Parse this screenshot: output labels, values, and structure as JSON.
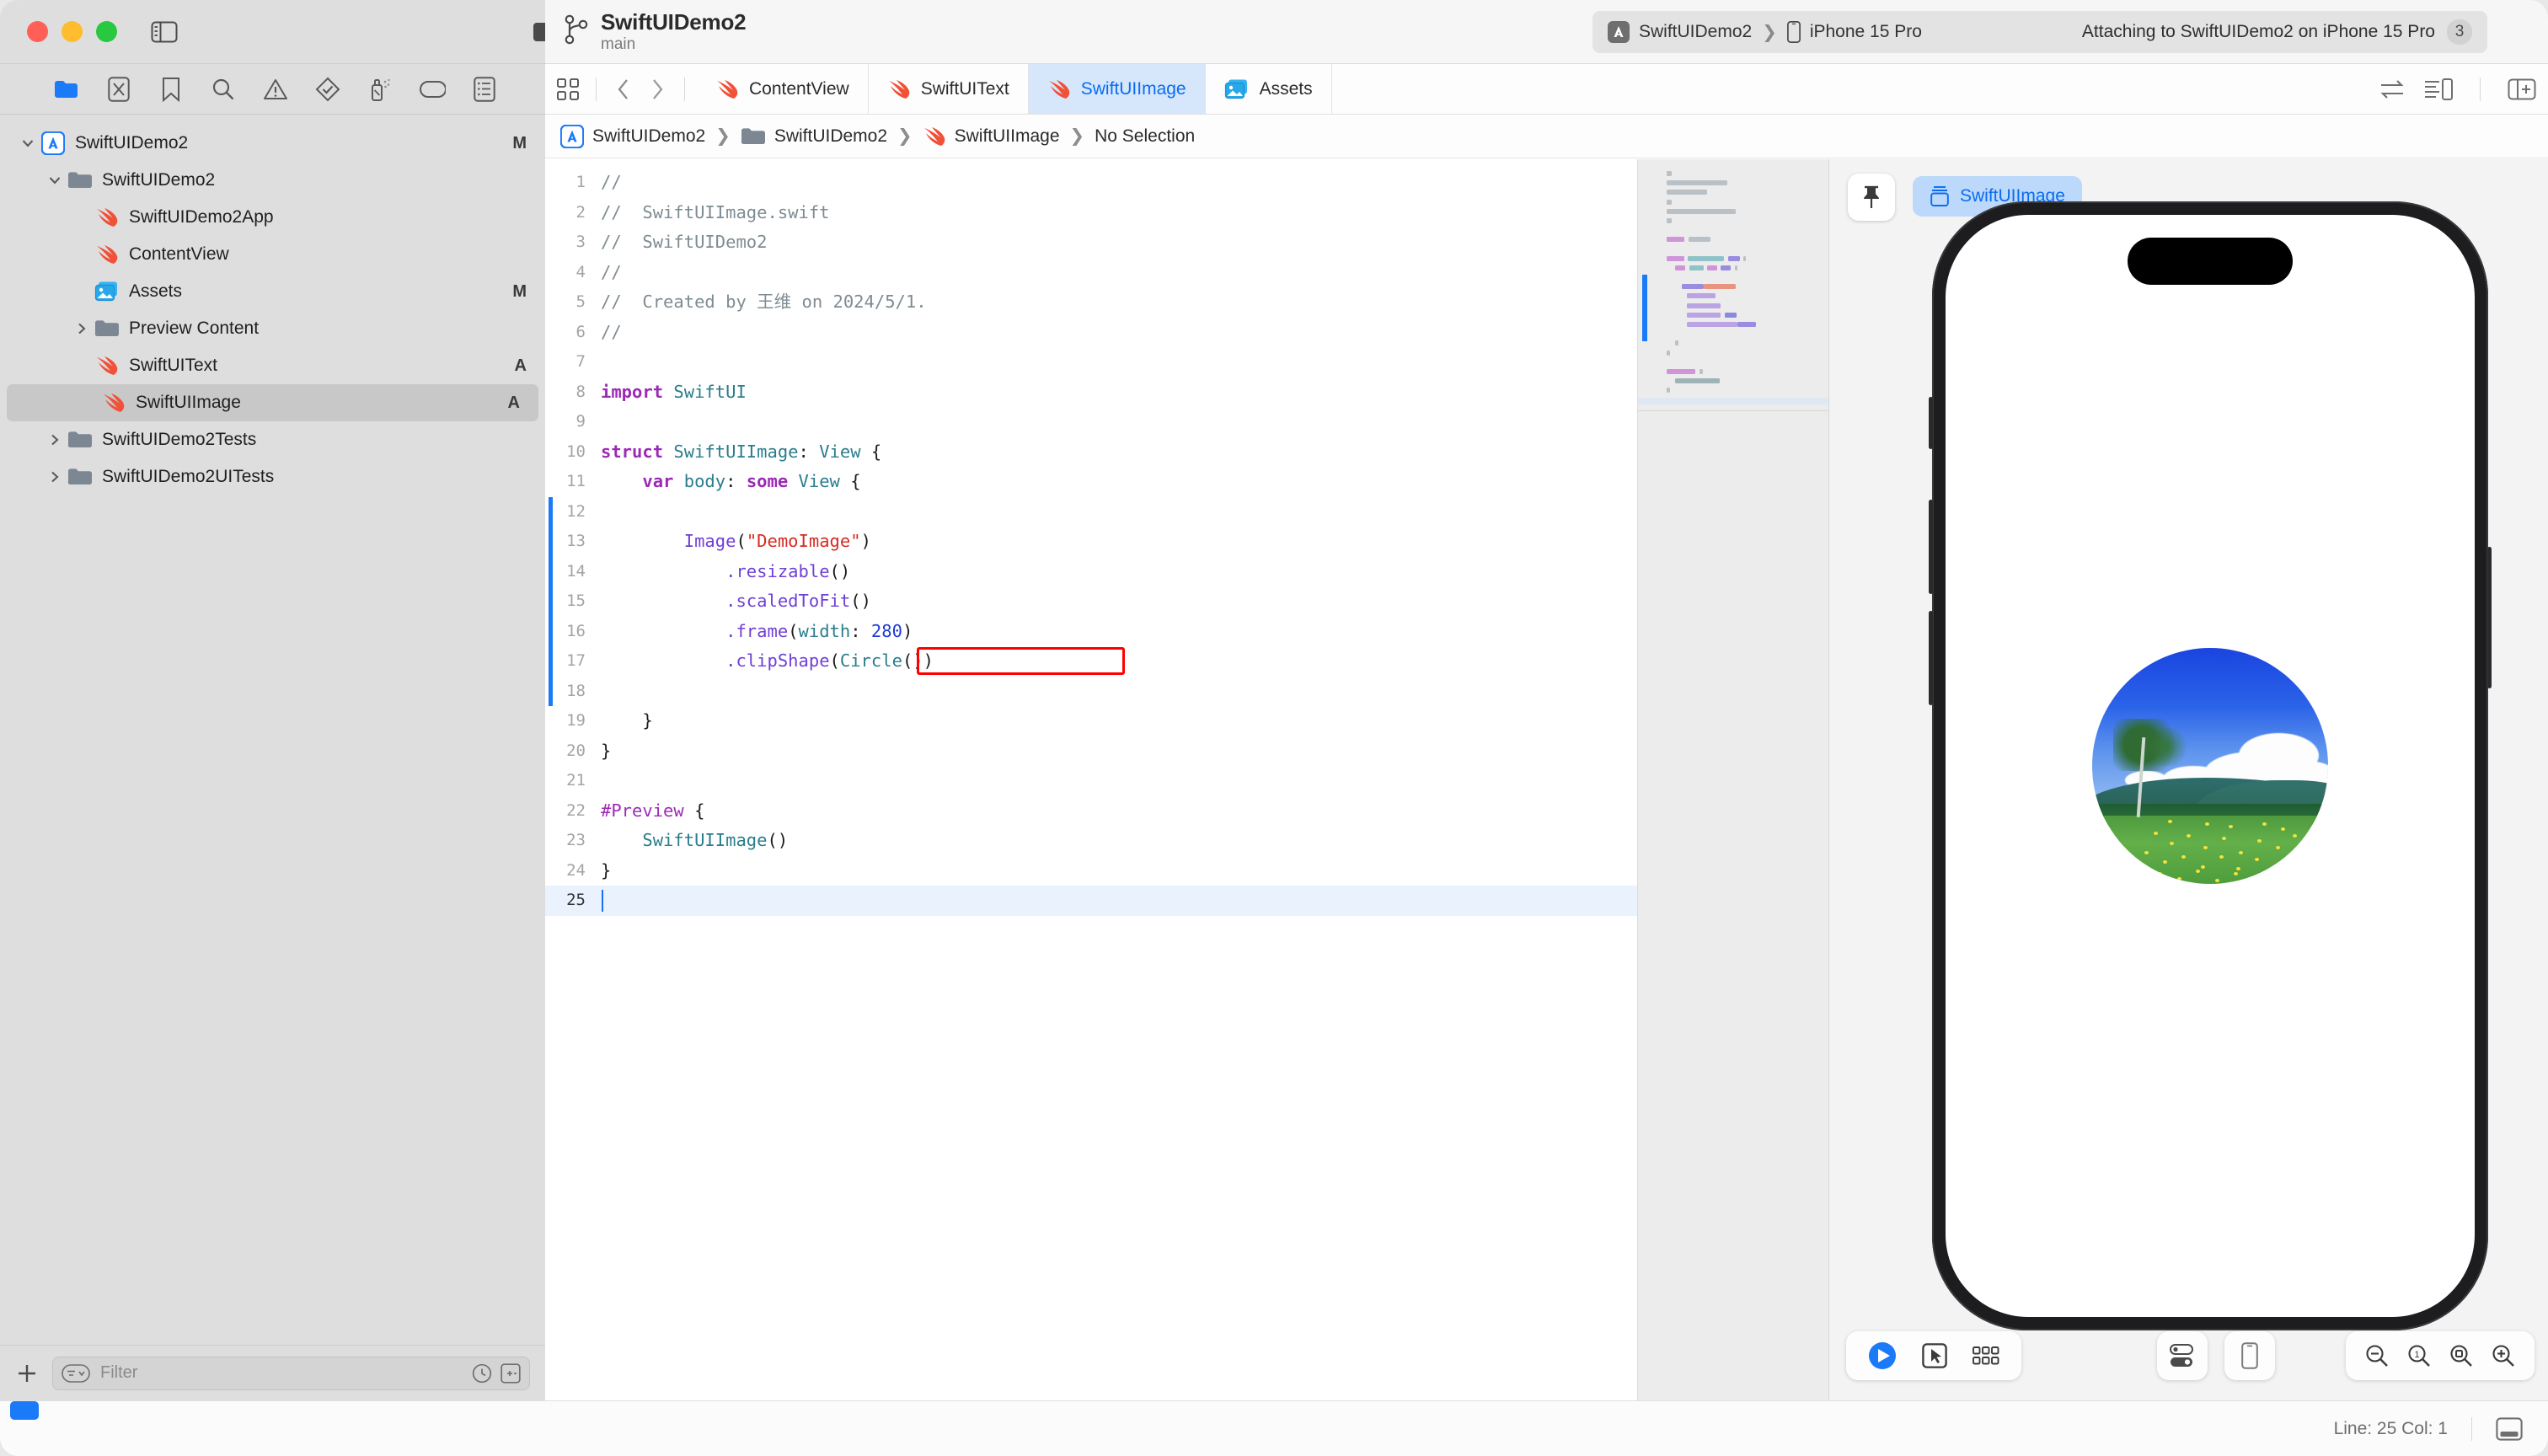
{
  "window": {
    "traffic_lights": [
      "close",
      "minimize",
      "maximize"
    ],
    "colors": {
      "close": "#ff5f57",
      "minimize": "#febc2e",
      "maximize": "#28c840",
      "accent": "#1a7af8",
      "annotation": "#ff0000",
      "tab_active_bg": "#d6e7fb",
      "tab_active_text": "#0a6cf0"
    }
  },
  "titlebar": {
    "project_title": "SwiftUIDemo2",
    "branch_name": "main",
    "scheme": "SwiftUIDemo2",
    "destination": "iPhone 15 Pro",
    "separator": "❯",
    "status_text": "Attaching to SwiftUIDemo2 on iPhone 15 Pro",
    "status_badge": "3",
    "icons": [
      "sidebar-toggle-icon",
      "stop-icon",
      "run-icon",
      "branch-icon",
      "app-icon",
      "device-icon",
      "cloud-icon",
      "plus-icon",
      "right-panel-toggle-icon"
    ]
  },
  "navigator": {
    "toolbar_icons": [
      "folder-icon",
      "source-control-icon",
      "bookmark-icon",
      "search-icon",
      "warning-icon",
      "test-icon",
      "debug-icon",
      "tag-icon",
      "report-icon"
    ],
    "active_toolbar_icon": "folder-icon",
    "tree": [
      {
        "label": "SwiftUIDemo2",
        "icon": "xcode-project-icon",
        "indent": 0,
        "expanded": true,
        "status": "M",
        "selected": false
      },
      {
        "label": "SwiftUIDemo2",
        "icon": "folder-icon",
        "indent": 1,
        "expanded": true,
        "status": "",
        "selected": false
      },
      {
        "label": "SwiftUIDemo2App",
        "icon": "swift-file-icon",
        "indent": 2,
        "expanded": null,
        "status": "",
        "selected": false
      },
      {
        "label": "ContentView",
        "icon": "swift-file-icon",
        "indent": 2,
        "expanded": null,
        "status": "",
        "selected": false
      },
      {
        "label": "Assets",
        "icon": "assets-icon",
        "indent": 2,
        "expanded": null,
        "status": "M",
        "selected": false
      },
      {
        "label": "Preview Content",
        "icon": "folder-icon",
        "indent": 2,
        "expanded": false,
        "status": "",
        "selected": false
      },
      {
        "label": "SwiftUIText",
        "icon": "swift-file-icon",
        "indent": 2,
        "expanded": null,
        "status": "A",
        "selected": false
      },
      {
        "label": "SwiftUIImage",
        "icon": "swift-file-icon",
        "indent": 2,
        "expanded": null,
        "status": "A",
        "selected": true
      },
      {
        "label": "SwiftUIDemo2Tests",
        "icon": "folder-icon",
        "indent": 1,
        "expanded": false,
        "status": "",
        "selected": false
      },
      {
        "label": "SwiftUIDemo2UITests",
        "icon": "folder-icon",
        "indent": 1,
        "expanded": false,
        "status": "",
        "selected": false
      }
    ],
    "bottom": {
      "add_label": "+",
      "filter_placeholder": "Filter",
      "icons": [
        "plus-icon",
        "filter-icon",
        "recent-icon",
        "source-control-filter-icon"
      ]
    }
  },
  "editor": {
    "tabs": [
      {
        "label": "ContentView",
        "icon": "swift-file-icon",
        "active": false
      },
      {
        "label": "SwiftUIText",
        "icon": "swift-file-icon",
        "active": false
      },
      {
        "label": "SwiftUIImage",
        "icon": "swift-file-icon",
        "active": true
      },
      {
        "label": "Assets",
        "icon": "assets-icon",
        "active": false
      }
    ],
    "tab_nav_icons": [
      "grid-icon",
      "back-icon",
      "forward-icon"
    ],
    "tab_right_icons": [
      "code-review-icon",
      "canvas-toggle-icon",
      "add-editor-icon"
    ],
    "breadcrumb": [
      {
        "label": "SwiftUIDemo2",
        "icon": "xcode-project-icon"
      },
      {
        "label": "SwiftUIDemo2",
        "icon": "folder-icon"
      },
      {
        "label": "SwiftUIImage",
        "icon": "swift-file-icon"
      },
      {
        "label": "No Selection",
        "icon": ""
      }
    ],
    "breadcrumb_separator": "❯",
    "code_lines": [
      {
        "n": 1,
        "text": "//"
      },
      {
        "n": 2,
        "text": "//  SwiftUIImage.swift"
      },
      {
        "n": 3,
        "text": "//  SwiftUIDemo2"
      },
      {
        "n": 4,
        "text": "//"
      },
      {
        "n": 5,
        "text": "//  Created by 王维 on 2024/5/1."
      },
      {
        "n": 6,
        "text": "//"
      },
      {
        "n": 7,
        "text": ""
      },
      {
        "n": 8,
        "text": "import SwiftUI"
      },
      {
        "n": 9,
        "text": ""
      },
      {
        "n": 10,
        "text": "struct SwiftUIImage: View {"
      },
      {
        "n": 11,
        "text": "    var body: some View {"
      },
      {
        "n": 12,
        "text": ""
      },
      {
        "n": 13,
        "text": "        Image(\"DemoImage\")"
      },
      {
        "n": 14,
        "text": "            .resizable()"
      },
      {
        "n": 15,
        "text": "            .scaledToFit()"
      },
      {
        "n": 16,
        "text": "            .frame(width: 280)"
      },
      {
        "n": 17,
        "text": "            .clipShape(Circle())"
      },
      {
        "n": 18,
        "text": ""
      },
      {
        "n": 19,
        "text": "    }"
      },
      {
        "n": 20,
        "text": "}"
      },
      {
        "n": 21,
        "text": ""
      },
      {
        "n": 22,
        "text": "#Preview {"
      },
      {
        "n": 23,
        "text": "    SwiftUIImage()"
      },
      {
        "n": 24,
        "text": "}"
      },
      {
        "n": 25,
        "text": ""
      }
    ],
    "annotated_line": 17,
    "current_line": 25
  },
  "preview": {
    "chip_label": "SwiftUIImage",
    "chip_icon": "layers-icon",
    "pin_icon": "pin-icon",
    "device": "iPhone 15 Pro",
    "control_icons": [
      "play-icon",
      "select-icon",
      "variants-icon"
    ],
    "settings_icon": "toggles-icon",
    "device_icon": "device-icon",
    "zoom_icons": [
      "zoom-out-icon",
      "zoom-actual-icon",
      "zoom-fit-icon",
      "zoom-in-icon"
    ],
    "zoom_actual_label": "1",
    "image_asset": "DemoImage",
    "image_description": "Landscape photo clipped to a circle: blue sky, white clouds, green mountains, grass field with yellow flowers, tree at left"
  },
  "statusbar": {
    "line_col": "Line: 25  Col: 1",
    "panel_toggle_icon": "bottom-panel-icon"
  }
}
